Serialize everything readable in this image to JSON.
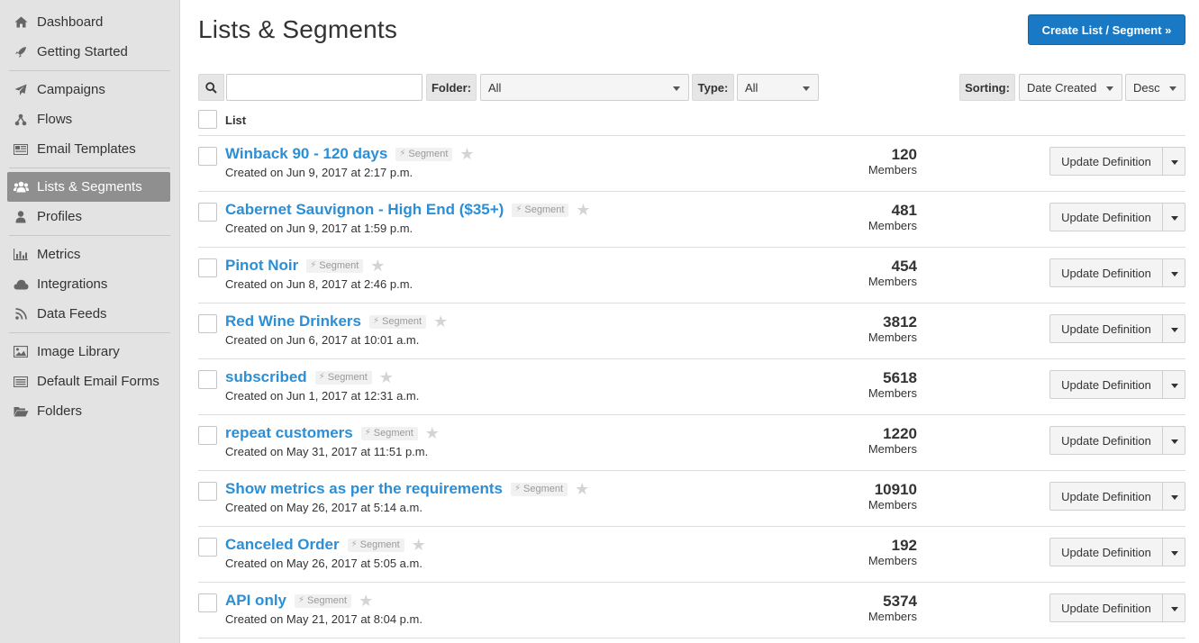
{
  "sidebar": {
    "groups": [
      [
        {
          "label": "Dashboard",
          "icon": "home-icon"
        },
        {
          "label": "Getting Started",
          "icon": "rocket-icon"
        }
      ],
      [
        {
          "label": "Campaigns",
          "icon": "paper-plane-icon"
        },
        {
          "label": "Flows",
          "icon": "flow-icon"
        },
        {
          "label": "Email Templates",
          "icon": "template-icon"
        }
      ],
      [
        {
          "label": "Lists & Segments",
          "icon": "users-icon",
          "active": true
        },
        {
          "label": "Profiles",
          "icon": "user-icon"
        }
      ],
      [
        {
          "label": "Metrics",
          "icon": "bar-chart-icon"
        },
        {
          "label": "Integrations",
          "icon": "cloud-icon"
        },
        {
          "label": "Data Feeds",
          "icon": "rss-icon"
        }
      ],
      [
        {
          "label": "Image Library",
          "icon": "image-icon"
        },
        {
          "label": "Default Email Forms",
          "icon": "form-icon"
        },
        {
          "label": "Folders",
          "icon": "folder-icon"
        }
      ]
    ]
  },
  "header": {
    "title": "Lists & Segments",
    "create_button": "Create List / Segment »"
  },
  "filters": {
    "search_value": "",
    "folder_label": "Folder:",
    "folder_value": "All",
    "type_label": "Type:",
    "type_value": "All",
    "sorting_label": "Sorting:",
    "sort_by_value": "Date Created",
    "sort_order_value": "Desc"
  },
  "list_header": {
    "label": "List"
  },
  "row_labels": {
    "tag": "Segment",
    "members": "Members",
    "update_button": "Update Definition"
  },
  "rows": [
    {
      "name": "Winback 90 - 120 days",
      "created": "Created on Jun 9, 2017 at 2:17 p.m.",
      "count": "120"
    },
    {
      "name": "Cabernet Sauvignon - High End ($35+)",
      "created": "Created on Jun 9, 2017 at 1:59 p.m.",
      "count": "481"
    },
    {
      "name": "Pinot Noir",
      "created": "Created on Jun 8, 2017 at 2:46 p.m.",
      "count": "454"
    },
    {
      "name": "Red Wine Drinkers",
      "created": "Created on Jun 6, 2017 at 10:01 a.m.",
      "count": "3812"
    },
    {
      "name": "subscribed",
      "created": "Created on Jun 1, 2017 at 12:31 a.m.",
      "count": "5618"
    },
    {
      "name": "repeat customers",
      "created": "Created on May 31, 2017 at 11:51 p.m.",
      "count": "1220"
    },
    {
      "name": "Show metrics as per the requirements",
      "created": "Created on May 26, 2017 at 5:14 a.m.",
      "count": "10910"
    },
    {
      "name": "Canceled Order",
      "created": "Created on May 26, 2017 at 5:05 a.m.",
      "count": "192"
    },
    {
      "name": "API only",
      "created": "Created on May 21, 2017 at 8:04 p.m.",
      "count": "5374"
    }
  ]
}
